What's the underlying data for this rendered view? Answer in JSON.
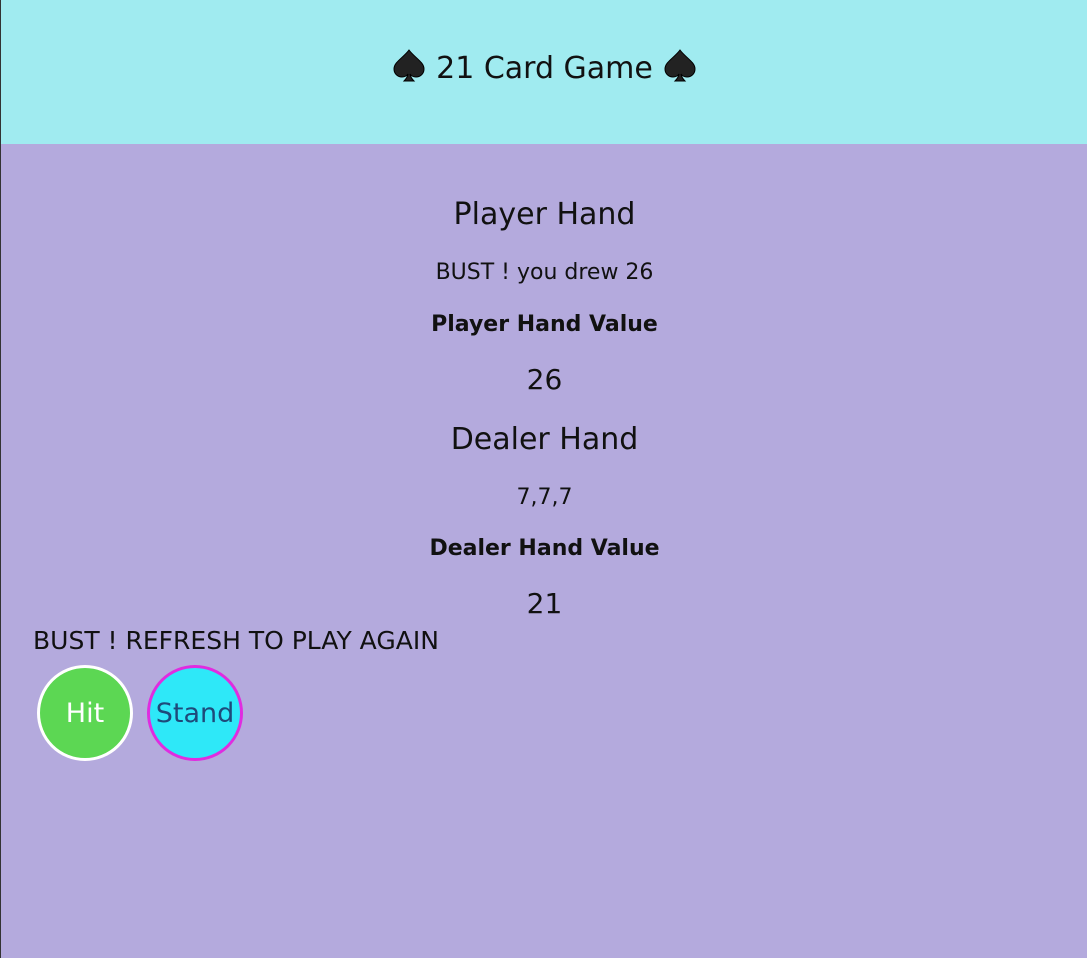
{
  "header": {
    "title": "21 Card Game",
    "left_icon": "spade-icon",
    "right_icon": "spade-icon",
    "background": "#a0ebf0"
  },
  "player": {
    "heading": "Player Hand",
    "message": "BUST ! you drew 26",
    "value_label": "Player Hand Value",
    "value": "26"
  },
  "dealer": {
    "heading": "Dealer Hand",
    "cards": "7,7,7",
    "value_label": "Dealer Hand Value",
    "value": "21"
  },
  "status": "BUST ! REFRESH TO PLAY AGAIN",
  "buttons": {
    "hit_label": "Hit",
    "stand_label": "Stand",
    "hit_color": "#5cd753",
    "stand_color": "#2ee8f8",
    "stand_border": "#e02ce0"
  },
  "page_background": "#b4aadd"
}
